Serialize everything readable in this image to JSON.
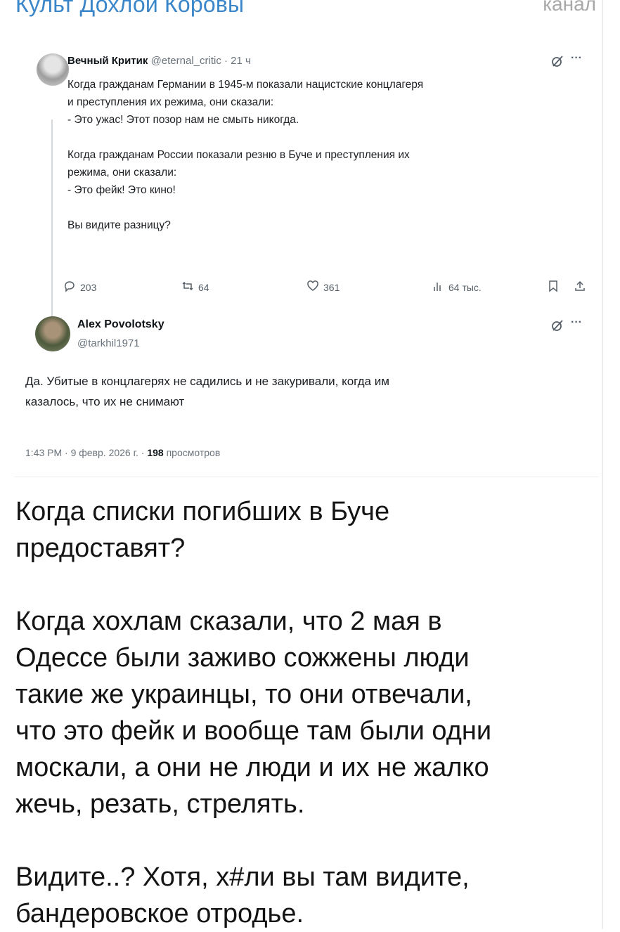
{
  "channel": {
    "title": "Культ Дохлой Коровы",
    "tag": "канал"
  },
  "tweet": {
    "author_name": "Вечный Критик",
    "author_handle": "@eternal_critic",
    "time": "21 ч",
    "body": "Когда гражданам Германии в 1945-м показали нацистские концлагеря\nи преступления их режима, они сказали:\n- Это ужас! Этот позор нам не смыть никогда.\n\nКогда гражданам России показали резню в Буче и преступления их\nрежима, они сказали:\n- Это фейк! Это кино!\n\nВы видите разницу?",
    "stats": {
      "replies": "203",
      "reposts": "64",
      "likes": "361",
      "views": "64 тыс."
    },
    "icons": [
      "grok-icon",
      "more-icon",
      "reply-icon",
      "repost-icon",
      "like-icon",
      "views-icon",
      "bookmark-icon",
      "share-icon"
    ]
  },
  "reply": {
    "author_name": "Alex Povolotsky",
    "author_handle": "@tarkhil1971",
    "body": "Да. Убитые в концлагерях не садились и не закуривали, когда им\nказалось, что их не снимают",
    "footer_time": "1:43 PM · 9 февр. 2026 г. ·",
    "views_count": "198",
    "views_label": "просмотров"
  },
  "post": {
    "text": "Когда списки погибших в Буче\nпредоставят?\n\nКогда хохлам сказали, что 2 мая в\nОдессе были заживо сожжены люди\nтакие же украинцы, то они отвечали,\nчто это фейк и вообще там были одни\nмоскали, а они не люди и их не жалко\nжечь, резать, стрелять.\n\nВидите..? Хотя, х#ли вы там видите,\nбандеровское отродье."
  }
}
